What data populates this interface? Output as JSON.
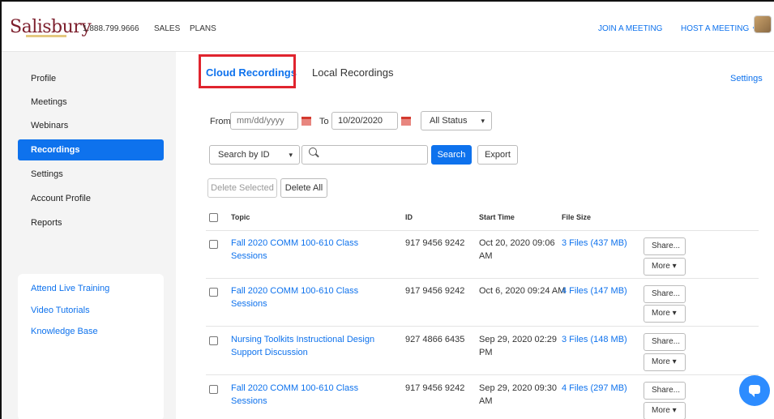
{
  "header": {
    "logo": "Salisbury",
    "phone": "1.888.799.9666",
    "sales": "SALES",
    "plans": "PLANS",
    "join_meeting": "JOIN A MEETING",
    "host_meeting": "HOST A MEETING"
  },
  "sidebar": {
    "items": [
      {
        "label": "Profile"
      },
      {
        "label": "Meetings"
      },
      {
        "label": "Webinars"
      },
      {
        "label": "Recordings"
      },
      {
        "label": "Settings"
      },
      {
        "label": "Account Profile"
      },
      {
        "label": "Reports"
      }
    ],
    "links": [
      {
        "label": "Attend Live Training"
      },
      {
        "label": "Video Tutorials"
      },
      {
        "label": "Knowledge Base"
      }
    ]
  },
  "tabs": {
    "cloud": "Cloud Recordings",
    "local": "Local Recordings",
    "settings": "Settings"
  },
  "filters": {
    "from_label": "From",
    "from_placeholder": "mm/dd/yyyy",
    "to_label": "To",
    "to_value": "10/20/2020",
    "status": "All Status",
    "search_by": "Search by ID",
    "search_button": "Search",
    "export_button": "Export",
    "delete_selected": "Delete Selected",
    "delete_all": "Delete All"
  },
  "table": {
    "headers": {
      "topic": "Topic",
      "id": "ID",
      "start_time": "Start Time",
      "file_size": "File Size"
    },
    "share_label": "Share...",
    "more_label": "More",
    "rows": [
      {
        "topic": "Fall 2020 COMM 100-610 Class Sessions",
        "id": "917 9456 9242",
        "start_time": "Oct 20, 2020 09:06 AM",
        "files": "3 Files (437 MB)"
      },
      {
        "topic": "Fall 2020 COMM 100-610 Class Sessions",
        "id": "917 9456 9242",
        "start_time": "Oct 6, 2020 09:24 AM",
        "files": "4 Files (147 MB)"
      },
      {
        "topic": "Nursing Toolkits Instructional Design Support Discussion",
        "id": "927 4866 6435",
        "start_time": "Sep 29, 2020 02:29 PM",
        "files": "3 Files (148 MB)"
      },
      {
        "topic": "Fall 2020 COMM 100-610 Class Sessions",
        "id": "917 9456 9242",
        "start_time": "Sep 29, 2020 09:30 AM",
        "files": "4 Files (297 MB)"
      }
    ]
  },
  "colors": {
    "accent": "#0e72ed",
    "highlight": "#e0242e",
    "brand": "#7c1e2c"
  }
}
